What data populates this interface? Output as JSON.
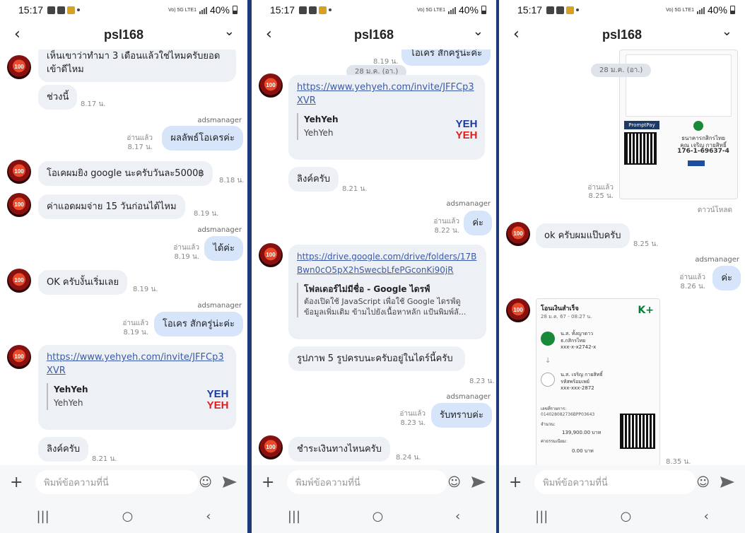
{
  "status": {
    "time": "15:17",
    "network": "Vo) 5G LTE1",
    "battery": "40%"
  },
  "chat_title": "psl168",
  "avatar_text": "100",
  "input_placeholder": "พิมพ์ข้อความที่นี่",
  "phone1": {
    "m1": {
      "text": "เห็นเขาว่าทำมา 3 เดือนแล้วใช่ไหมครับยอดเข้าดีไหม"
    },
    "m2": {
      "text": "ช่วงนี้",
      "time": "8.17 น."
    },
    "m3": {
      "sender": "adsmanager",
      "read": "อ่านแล้ว",
      "time": "8.17 น.",
      "text": "ผลลัพธ์โอเครค่ะ"
    },
    "m4": {
      "text": "โอเคผมยิง google นะครับวันละ5000฿",
      "time": "8.18 น."
    },
    "m5": {
      "text": "ค่าแอดผมจ่าย 15 วันก่อนได้ไหม",
      "time": "8.19 น."
    },
    "m6": {
      "sender": "adsmanager",
      "read": "อ่านแล้ว",
      "time": "8.19 น.",
      "text": "ได้ค่ะ"
    },
    "m7": {
      "text": "OK ครับงั้นเริ่มเลย",
      "time": "8.19 น."
    },
    "m8": {
      "sender": "adsmanager",
      "read": "อ่านแล้ว",
      "time": "8.19 น.",
      "text": "โอเคร สักครู่น่ะค่ะ"
    },
    "m9": {
      "link": "https://www.yehyeh.com/invite/JFFCp3XVR",
      "card_title": "YehYeh",
      "card_desc": "YehYeh"
    },
    "m10": {
      "text": "ลิงค์ครับ",
      "time": "8.21 น."
    }
  },
  "phone2": {
    "m0": {
      "text": "โอเคร สักครู่น่ะค่ะ",
      "time": "8.19 น."
    },
    "date_chip": "28 ม.ค. (อา.)",
    "m1": {
      "link": "https://www.yehyeh.com/invite/JFFCp3XVR",
      "card_title": "YehYeh",
      "card_desc": "YehYeh"
    },
    "m2": {
      "text": "ลิงค์ครับ",
      "time": "8.21 น."
    },
    "m3": {
      "sender": "adsmanager",
      "read": "อ่านแล้ว",
      "time": "8.22 น.",
      "text": "ค่ะ"
    },
    "m4": {
      "link": "https://drive.google.com/drive/folders/17BBwn0cO5pX2hSwecbLfePGconKi90jR",
      "card_title": "โฟลเดอร์ไม่มีชื่อ - Google ไดรฟ์",
      "card_desc": "ต้องเปิดใช้ JavaScript เพื่อใช้ Google ไดรฟ์ดูข้อมูลเพิ่มเติม ข้ามไปยังเนื้อหาหลัก แป้นพิมพ์ลั..."
    },
    "m5": {
      "text": "รูปภาพ 5 รูปครบนะครับอยู่ในไดร์นี้ครับ",
      "time": "8.23 น."
    },
    "m6": {
      "sender": "adsmanager",
      "read": "อ่านแล้ว",
      "time": "8.23 น.",
      "text": "รับทราบค่ะ"
    },
    "m7": {
      "text": "ชำระเงินทางไหนครับ",
      "time": "8.24 น."
    }
  },
  "phone3": {
    "date_chip": "28 ม.ค. (อา.)",
    "m1": {
      "read": "อ่านแล้ว",
      "time": "8.25 น.",
      "download": "ดาวน์โหลด",
      "promptpay": "PromptPay",
      "bank": "ธนาคารกสิกรไทย",
      "name": "คุณ เจริญ กายสิทธิ์",
      "acct": "176-1-69637-4"
    },
    "m2": {
      "text": "ok ครับผมแป๊บครับ",
      "time": "8.25 น."
    },
    "m3": {
      "sender": "adsmanager",
      "read": "อ่านแล้ว",
      "time": "8.26 น.",
      "text": "ค่ะ"
    },
    "m4": {
      "time": "8.35 น.",
      "slip_title": "โอนเงินสำเร็จ",
      "slip_date": "28 ม.ค. 67 - 08:27 น.",
      "brand": "K+",
      "from_name": "น.ส. ทั้งญาดาว",
      "from_bank": "ธ.กสิกรไทย",
      "from_acct": "xxx-x-x2742-x",
      "to_name": "น.ส. เจริญ กายสิทธิ์",
      "to_bank": "รหัสพร้อมเพย์",
      "to_acct": "xxx-xxx-2872",
      "ref_label": "เลขที่รายการ:",
      "ref": "014028082736BPP03643",
      "amount_label": "จำนวน:",
      "amount": "139,900.00 บาท",
      "fee_label": "ค่าธรรมเนียม:",
      "fee": "0.00 บาท"
    }
  }
}
